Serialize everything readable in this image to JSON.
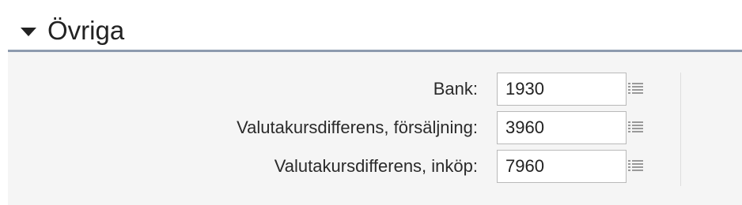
{
  "section": {
    "title": "Övriga"
  },
  "rows": [
    {
      "label": "Bank:",
      "value": "1930"
    },
    {
      "label": "Valutakursdifferens, försäljning:",
      "value": "3960"
    },
    {
      "label": "Valutakursdifferens, inköp:",
      "value": "7960"
    }
  ],
  "icons": {
    "collapse": "caret-down-icon",
    "lookup": "list-icon"
  },
  "colors": {
    "header_border": "#8d9aae",
    "panel_background": "#f5f5f5"
  }
}
